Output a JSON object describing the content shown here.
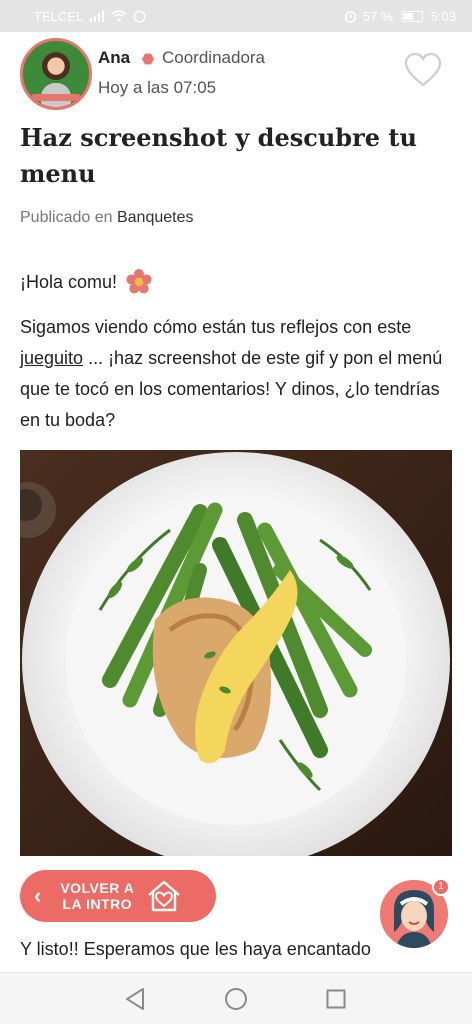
{
  "status_bar": {
    "carrier": "TELCEL",
    "battery": "57 %",
    "battery_level": 0.57,
    "time": "5:03",
    "icons": [
      "signal-icon",
      "wifi-icon",
      "whatsapp-icon",
      "alarm-icon",
      "battery-icon"
    ]
  },
  "post": {
    "author": "Ana",
    "role": "Coordinadora",
    "time": "Hoy a las 07:05",
    "title": "Haz screenshot y descubre tu menu",
    "published_prefix": "Publicado en",
    "category": "Banquetes",
    "greeting": "¡Hola comu!",
    "body_before_link": "Sigamos viendo cómo están tus reflejos con este ",
    "body_link": "jueguito",
    "body_after_link": " ... ¡haz screenshot de este gif y pon el menú que te tocó en los comentarios! Y dinos, ¿lo tendrías en tu boda?",
    "bottom_text": "Y listo!! Esperamos que les haya encantado"
  },
  "back_button": {
    "label_line1": "VOLVER A",
    "label_line2": "LA INTRO"
  },
  "chat": {
    "badge_count": "1"
  },
  "colors": {
    "accent": "#ec6b64",
    "status_bar": "#e4e4e4"
  }
}
